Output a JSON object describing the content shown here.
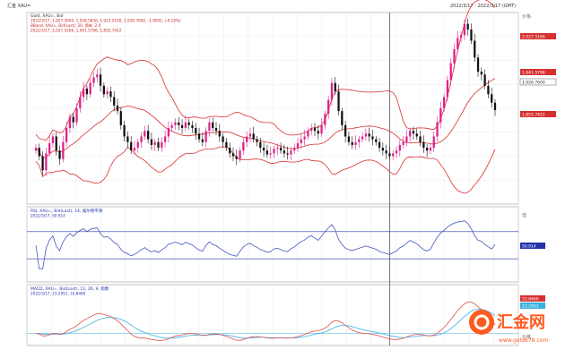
{
  "header": {
    "top_left": "汇金 XAU=",
    "top_right": "2022/3/17 - 2022/3/17 (GMT)"
  },
  "panels": {
    "main": {
      "line1": "Gold, XAU=, Bid",
      "line2": "2022/3/17, 1,927.2650, 1,936.5836, 1,923.5100, 1,926.7600, -1.9002, (-0.10%)",
      "line3": "BBand, XAU=, Bid(Last), 20, 简单, 2.0",
      "line4": "2022/3/17, 2,027.5166, 1,941.5796, 1,855.7422",
      "y_axis_title": "价格",
      "price_tag": "1,926.7600",
      "upper_tag": "2,027.5166",
      "mid_tag": "1,941.5796",
      "lower_tag": "1,855.7422"
    },
    "rsi": {
      "line1": "RSI, XAU=, Bid(Last), 14, 威尔德平滑",
      "line2": "2022/3/17, 50.914",
      "y_axis_title": "值",
      "value_tag": "50.914"
    },
    "macd": {
      "line1": "MACD, XAU=, Bid(Last), 12, 26, 9, 指数",
      "line2": "2022/3/17, 23.2951, 33.8460",
      "y_axis_title": "价格",
      "tag1": "33.8460",
      "tag2": "23.2951"
    }
  },
  "watermark": {
    "brand": "汇金网",
    "url": "www.gold678.com"
  },
  "colors": {
    "up": "#e0218a",
    "down": "#111111",
    "bband": "#d83030",
    "rsi": "#4455c0",
    "macd": "#e05050",
    "signal": "#3ab0e0",
    "band_line": "#2233aa",
    "watermark": "#ff5a1f"
  },
  "chart_data": [
    {
      "type": "candlestick",
      "series": "XAU= Bid",
      "note": "Approximate daily closes (left to right)",
      "close": [
        1860,
        1845,
        1820,
        1850,
        1868,
        1880,
        1855,
        1840,
        1870,
        1895,
        1915,
        1905,
        1930,
        1950,
        1965,
        1955,
        1975,
        1985,
        1990,
        1970,
        1955,
        1960,
        1950,
        1935,
        1925,
        1900,
        1880,
        1870,
        1855,
        1860,
        1870,
        1880,
        1890,
        1875,
        1865,
        1870,
        1860,
        1870,
        1880,
        1895,
        1900,
        1905,
        1900,
        1895,
        1905,
        1900,
        1895,
        1885,
        1875,
        1870,
        1890,
        1905,
        1895,
        1890,
        1880,
        1870,
        1860,
        1850,
        1845,
        1840,
        1855,
        1870,
        1880,
        1885,
        1875,
        1870,
        1860,
        1855,
        1848,
        1850,
        1858,
        1860,
        1855,
        1850,
        1848,
        1855,
        1860,
        1868,
        1875,
        1880,
        1890,
        1895,
        1890,
        1885,
        1900,
        1920,
        1945,
        1975,
        1960,
        1925,
        1900,
        1880,
        1870,
        1865,
        1870,
        1875,
        1880,
        1885,
        1880,
        1875,
        1870,
        1860,
        1855,
        1850,
        1845,
        1850,
        1855,
        1865,
        1870,
        1880,
        1890,
        1885,
        1880,
        1870,
        1860,
        1855,
        1860,
        1880,
        1905,
        1930,
        1950,
        1980,
        2010,
        2035,
        2055,
        2060,
        2080,
        2070,
        2050,
        2020,
        1995,
        1990,
        1970,
        1955,
        1940,
        1926.76
      ]
    },
    {
      "type": "line",
      "series": "BBand (20, 2.0)",
      "last": {
        "upper": 2027.5166,
        "middle": 1941.5796,
        "lower": 1855.7422
      }
    },
    {
      "type": "line",
      "series": "RSI (14)",
      "ylim": [
        0,
        100
      ],
      "levels": [
        70,
        30
      ],
      "last": 50.914
    },
    {
      "type": "line",
      "series": "MACD (12, 26, 9)",
      "last": {
        "macd": 33.846,
        "signal": 23.2951
      }
    }
  ]
}
